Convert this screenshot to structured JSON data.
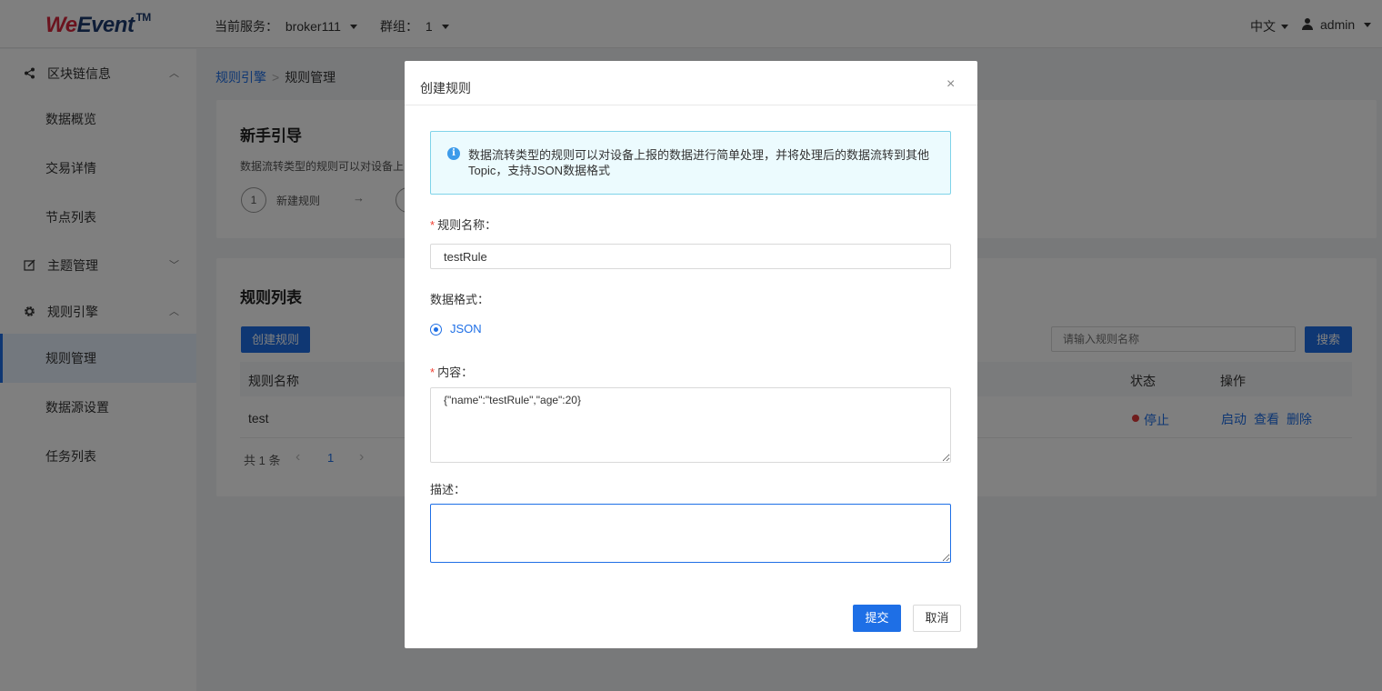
{
  "header": {
    "logo_we": "We",
    "logo_event": "Event",
    "logo_tm": "TM",
    "service_label": "当前服务：",
    "service_value": "broker111",
    "group_label": "群组：",
    "group_value": "1",
    "language": "中文",
    "user": "admin"
  },
  "sidebar": {
    "items": [
      {
        "label": "区块链信息",
        "icon": "share-nodes-icon"
      },
      {
        "label": "数据概览"
      },
      {
        "label": "交易详情"
      },
      {
        "label": "节点列表"
      },
      {
        "label": "主题管理",
        "icon": "edit-icon"
      },
      {
        "label": "规则引擎",
        "icon": "gear-icon"
      },
      {
        "label": "规则管理"
      },
      {
        "label": "数据源设置"
      },
      {
        "label": "任务列表"
      }
    ]
  },
  "breadcrumb": {
    "parent": "规则引擎",
    "current": "规则管理"
  },
  "guide": {
    "title": "新手引导",
    "desc": "数据流转类型的规则可以对设备上",
    "step1_num": "1",
    "step1_label": "新建规则",
    "arrow": "→"
  },
  "rules": {
    "title": "规则列表",
    "create_button": "创建规则",
    "search_placeholder": "请输入规则名称",
    "search_button": "搜索",
    "columns": {
      "name": "规则名称",
      "status": "状态",
      "actions": "操作"
    },
    "rows": [
      {
        "name": "test",
        "status": "停止",
        "status_color": "#e03a3a",
        "actions": [
          "启动",
          "查看",
          "删除"
        ]
      }
    ],
    "pagination": {
      "total": "共 1 条",
      "prev": "‹",
      "page": "1",
      "next": "›"
    }
  },
  "modal": {
    "title": "创建规则",
    "close": "×",
    "alert_icon": "i",
    "alert": "数据流转类型的规则可以对设备上报的数据进行简单处理，并将处理后的数据流转到其他Topic，支持JSON数据格式",
    "name_required": "*",
    "name_label": "规则名称：",
    "name_value": "testRule",
    "format_label": "数据格式：",
    "format_option": "JSON",
    "content_required": "*",
    "content_label": "内容：",
    "content_value": "{\"name\":\"testRule\",\"age\":20}",
    "desc_label": "描述：",
    "desc_value": "",
    "submit": "提交",
    "cancel": "取消"
  },
  "colors": {
    "primary": "#1e6fe6",
    "alert_bg": "#ecfbfe",
    "alert_border": "#7fd3e9",
    "stop": "#e03a3a"
  }
}
